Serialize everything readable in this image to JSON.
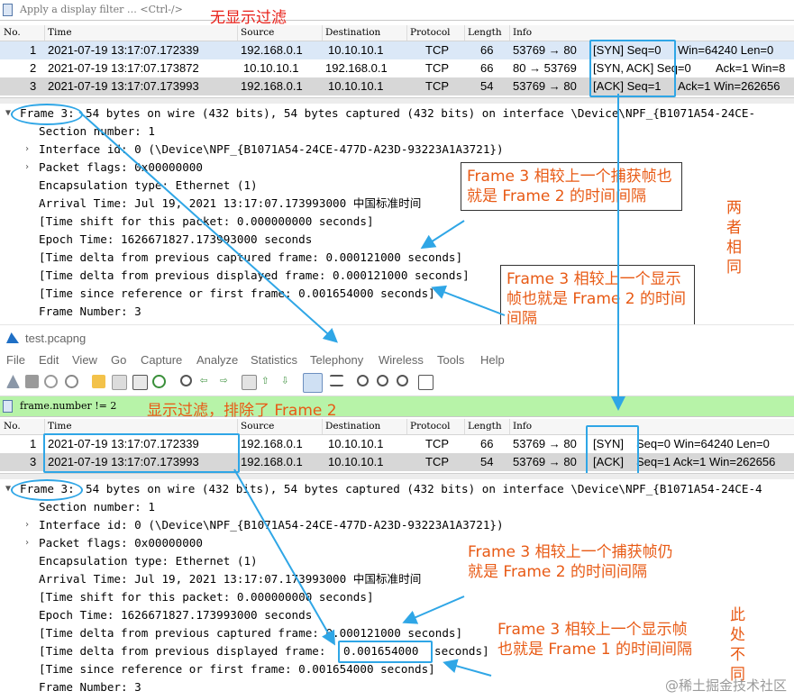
{
  "top": {
    "filter_placeholder": "Apply a display filter … <Ctrl-/>",
    "filter_annotation": "无显示过滤",
    "columns": [
      "No.",
      "Time",
      "Source",
      "Destination",
      "Protocol",
      "Length",
      "Info"
    ],
    "rows": [
      {
        "no": "1",
        "time": "2021-07-19 13:17:07.172339",
        "src": "192.168.0.1",
        "dst": "10.10.10.1",
        "proto": "TCP",
        "len": "66",
        "info_pre": "53769 → 80",
        "flag": "[SYN] Seq=0",
        "info_post": "Win=64240 Len=0"
      },
      {
        "no": "2",
        "time": "2021-07-19 13:17:07.173872",
        "src": "10.10.10.1",
        "dst": "192.168.0.1",
        "proto": "TCP",
        "len": "66",
        "info_pre": "80 → 53769",
        "flag": "[SYN, ACK] Seq=0",
        "info_post": "Ack=1 Win=8"
      },
      {
        "no": "3",
        "time": "2021-07-19 13:17:07.173993",
        "src": "192.168.0.1",
        "dst": "10.10.10.1",
        "proto": "TCP",
        "len": "54",
        "info_pre": "53769 → 80",
        "flag": "[ACK] Seq=1",
        "info_post": "Ack=1 Win=262656"
      }
    ],
    "detail": {
      "frame": "Frame 3:",
      "frame_rest": "54 bytes on wire (432 bits), 54 bytes captured (432 bits) on interface \\Device\\NPF_{B1071A54-24CE-",
      "section": "Section number: 1",
      "interface": "Interface id: 0 (\\Device\\NPF_{B1071A54-24CE-477D-A23D-93223A1A3721})",
      "flags": "Packet flags: 0x00000000",
      "encap": "Encapsulation type: Ethernet (1)",
      "arrival": "Arrival Time: Jul 19, 2021 13:17:07.173993000 中国标准时间",
      "shift": "[Time shift for this packet: 0.000000000 seconds]",
      "epoch": "Epoch Time: 1626671827.173993000 seconds",
      "delta_cap": "[Time delta from previous captured frame: 0.000121000 seconds]",
      "delta_disp": "[Time delta from previous displayed frame: 0.000121000 seconds]",
      "since_ref": "[Time since reference or first frame: 0.001654000 seconds]",
      "number": "Frame Number: 3"
    },
    "callout1": "Frame 3 相较上一个捕获帧也就是 Frame 2 的时间间隔",
    "callout2": "Frame 3 相较上一个显示帧也就是 Frame 2 的时间间隔",
    "side_note": "两者相同"
  },
  "window": {
    "title": "test.pcapng",
    "menu": [
      "File",
      "Edit",
      "View",
      "Go",
      "Capture",
      "Analyze",
      "Statistics",
      "Telephony",
      "Wireless",
      "Tools",
      "Help"
    ]
  },
  "bottom": {
    "filter_value": "frame.number != 2",
    "filter_annotation": "显示过滤，排除了 Frame 2",
    "columns": [
      "No.",
      "Time",
      "Source",
      "Destination",
      "Protocol",
      "Length",
      "Info"
    ],
    "rows": [
      {
        "no": "1",
        "time": "2021-07-19 13:17:07.172339",
        "src": "192.168.0.1",
        "dst": "10.10.10.1",
        "proto": "TCP",
        "len": "66",
        "info_pre": "53769 → 80",
        "flag": "[SYN]",
        "info_post": "Seq=0 Win=64240 Len=0"
      },
      {
        "no": "3",
        "time": "2021-07-19 13:17:07.173993",
        "src": "192.168.0.1",
        "dst": "10.10.10.1",
        "proto": "TCP",
        "len": "54",
        "info_pre": "53769 → 80",
        "flag": "[ACK]",
        "info_post": "Seq=1 Ack=1 Win=262656"
      }
    ],
    "detail": {
      "frame": "Frame 3:",
      "frame_rest": "54 bytes on wire (432 bits), 54 bytes captured (432 bits) on interface \\Device\\NPF_{B1071A54-24CE-4",
      "section": "Section number: 1",
      "interface": "Interface id: 0 (\\Device\\NPF_{B1071A54-24CE-477D-A23D-93223A1A3721})",
      "flags": "Packet flags: 0x00000000",
      "encap": "Encapsulation type: Ethernet (1)",
      "arrival": "Arrival Time: Jul 19, 2021 13:17:07.173993000 中国标准时间",
      "shift": "[Time shift for this packet: 0.000000000 seconds]",
      "epoch": "Epoch Time: 1626671827.173993000 seconds",
      "delta_cap": "[Time delta from previous captured frame: 0.000121000 seconds]",
      "delta_disp_pre": "[Time delta from previous displayed frame:",
      "delta_disp_val": "0.001654000",
      "delta_disp_post": "seconds]",
      "since_ref": "[Time since reference or first frame: 0.001654000 seconds]",
      "number": "Frame Number: 3"
    },
    "callout1": "Frame 3 相较上一个捕获帧仍就是 Frame 2 的时间间隔",
    "callout2": "Frame 3 相较上一个显示帧也就是 Frame 1 的时间间隔",
    "side_note": "此处不同"
  },
  "watermark": "@稀土掘金技术社区",
  "colors": {
    "highlight": "#2fa6e6",
    "annotation": "#e85a15",
    "filter_green": "#b7f3a8"
  }
}
